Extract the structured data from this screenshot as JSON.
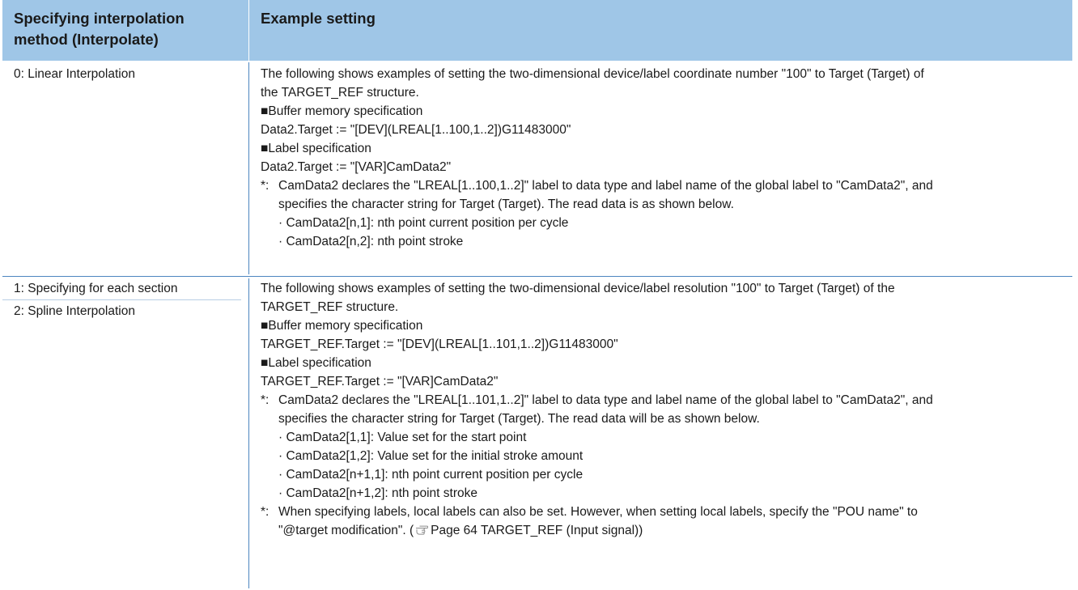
{
  "header": {
    "col1": [
      "Specifying interpolation",
      "method (Interpolate)"
    ],
    "col2": "Example setting"
  },
  "row1": {
    "method": "0: Linear Interpolation",
    "intro": [
      "The following shows examples of setting the two-dimensional device/label coordinate number \"100\" to Target (Target) of",
      "the TARGET_REF structure."
    ],
    "buffer_heading": "■Buffer memory specification",
    "buffer_code": "Data2.Target := \"[DEV](LREAL[1..100,1..2])G11483000\"",
    "label_heading": "■Label specification",
    "label_code": "Data2.Target := \"[VAR]CamData2\"",
    "note_mark": "*:",
    "note_lines": [
      "CamData2 declares the \"LREAL[1..100,1..2]\" label to data type and label name of the global label to \"CamData2\", and",
      "specifies the character string for Target (Target). The read data is as shown below."
    ],
    "items": [
      "· CamData2[n,1]: nth point current position per cycle",
      "· CamData2[n,2]: nth point stroke"
    ]
  },
  "row2": {
    "method1": "1: Specifying for each section",
    "method2": "2: Spline Interpolation",
    "intro": [
      "The following shows examples of setting the two-dimensional device/label resolution \"100\" to Target (Target) of the",
      "TARGET_REF structure."
    ],
    "buffer_heading": "■Buffer memory specification",
    "buffer_code": "TARGET_REF.Target := \"[DEV](LREAL[1..101,1..2])G11483000\"",
    "label_heading": "■Label specification",
    "label_code": "TARGET_REF.Target := \"[VAR]CamData2\"",
    "note_mark": "*:",
    "note_lines": [
      "CamData2 declares the \"LREAL[1..101,1..2]\" label to data type and label name of the global label to \"CamData2\", and",
      "specifies the character string for Target (Target). The read data will be as shown below."
    ],
    "items": [
      "· CamData2[1,1]: Value set for the start point",
      "· CamData2[1,2]: Value set for the initial stroke amount",
      "· CamData2[n+1,1]: nth point current position per cycle",
      "· CamData2[n+1,2]: nth point stroke"
    ],
    "note2_mark": "*:",
    "note2_line1": "When specifying labels, local labels can also be set. However, when setting local labels, specify the \"POU name\" to",
    "note2_line2_pre": "\"@target modification\". (",
    "note2_ref_icon": "pointing-hand-icon",
    "note2_line2_ref": "Page 64 TARGET_REF (Input signal))"
  }
}
